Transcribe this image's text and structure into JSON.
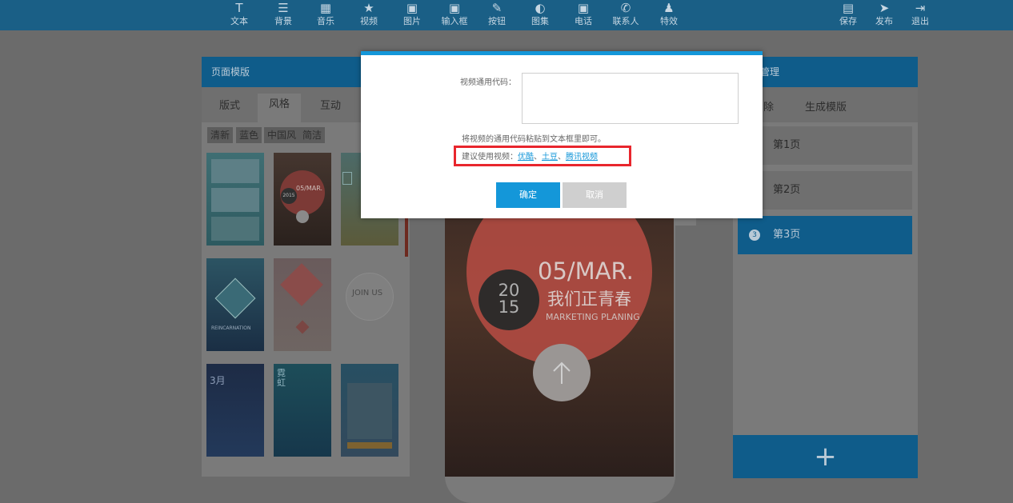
{
  "toolbar": {
    "items": [
      {
        "icon": "text-icon",
        "glyph": "T",
        "label": "文本"
      },
      {
        "icon": "background-icon",
        "glyph": "☰",
        "label": "背景"
      },
      {
        "icon": "music-icon",
        "glyph": "▦",
        "label": "音乐"
      },
      {
        "icon": "video-icon",
        "glyph": "★",
        "label": "视频"
      },
      {
        "icon": "image-icon",
        "glyph": "▣",
        "label": "图片"
      },
      {
        "icon": "input-icon",
        "glyph": "▣",
        "label": "输入框"
      },
      {
        "icon": "button-icon",
        "glyph": "✎",
        "label": "按钮"
      },
      {
        "icon": "gallery-icon",
        "glyph": "◐",
        "label": "图集"
      },
      {
        "icon": "phone-icon",
        "glyph": "▣",
        "label": "电话"
      },
      {
        "icon": "contact-icon",
        "glyph": "✆",
        "label": "联系人"
      },
      {
        "icon": "effects-icon",
        "glyph": "♟",
        "label": "特效"
      }
    ],
    "right": [
      {
        "icon": "save-icon",
        "glyph": "▤",
        "label": "保存"
      },
      {
        "icon": "publish-icon",
        "glyph": "➤",
        "label": "发布"
      },
      {
        "icon": "exit-icon",
        "glyph": "⇥",
        "label": "退出"
      }
    ]
  },
  "template_panel": {
    "title": "页面模版",
    "tabs": [
      "版式",
      "风格",
      "互动"
    ],
    "filters": [
      "清新",
      "蓝色",
      "中国风",
      "简洁"
    ],
    "thumb_texts": {
      "t2_date": "05/MAR.",
      "t2_year": "2015",
      "t4_text": "REINCARNATION",
      "t6_text": "JOIN US",
      "t7_text": "3月",
      "t8_text": "霓虹"
    }
  },
  "preview": {
    "year": "2015",
    "date": "05/MAR.",
    "headline": "我们正青春",
    "subtitle": "MARKETING PLANING"
  },
  "page_manager": {
    "title": "管理",
    "actions": [
      "除",
      "生成模版"
    ],
    "pages": [
      {
        "label": "第1页"
      },
      {
        "label": "第2页"
      },
      {
        "label": "第3页",
        "index": "3",
        "active": true
      }
    ],
    "add_glyph": "+"
  },
  "dialog": {
    "code_label": "视频通用代码：",
    "code_value": "",
    "hint": "将视频的通用代码粘贴到文本框里即可。",
    "suggest_prefix": "建议使用视频：",
    "links": [
      "优酷",
      "土豆",
      "腾讯视频"
    ],
    "separator": "、",
    "confirm_label": "确定",
    "cancel_label": "取消"
  },
  "colors": {
    "accent": "#1497d9",
    "highlight_box": "#e8262d",
    "cancel_gray": "#cfcfcf"
  }
}
